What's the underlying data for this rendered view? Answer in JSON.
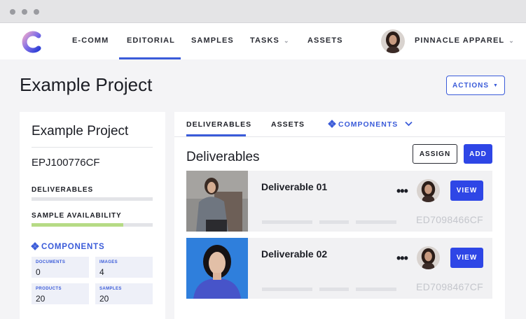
{
  "nav": {
    "items": [
      {
        "label": "E-COMM"
      },
      {
        "label": "EDITORIAL"
      },
      {
        "label": "SAMPLES"
      },
      {
        "label": "TASKS"
      },
      {
        "label": "ASSETS"
      }
    ],
    "org_name": "PINNACLE APPAREL"
  },
  "page": {
    "title": "Example Project",
    "actions_label": "ACTIONS"
  },
  "project": {
    "name": "Example Project",
    "code": "EPJ100776CF",
    "deliverables_label": "DELIVERABLES",
    "deliverables_progress": 0,
    "sample_label": "SAMPLE AVAILABILITY",
    "sample_progress": 0.76,
    "components_label": "COMPONENTS",
    "stats": [
      {
        "label": "DOCUMENTS",
        "value": "0"
      },
      {
        "label": "IMAGES",
        "value": "4"
      },
      {
        "label": "PRODUCTS",
        "value": "20"
      },
      {
        "label": "SAMPLES",
        "value": "20"
      }
    ]
  },
  "tabs": [
    {
      "label": "DELIVERABLES"
    },
    {
      "label": "ASSETS"
    },
    {
      "label": "COMPONENTS"
    }
  ],
  "deliverables": {
    "title": "Deliverables",
    "assign_label": "ASSIGN",
    "add_label": "ADD",
    "rows": [
      {
        "name": "Deliverable 01",
        "code": "ED7098466CF",
        "view_label": "VIEW",
        "more": "•••"
      },
      {
        "name": "Deliverable 02",
        "code": "ED7098467CF",
        "view_label": "VIEW",
        "more": "•••"
      }
    ]
  },
  "icons": {
    "logo": "brand-c-logo",
    "components": "diamond-cluster-icon",
    "dropdown": "chevron-down-icon"
  },
  "colors": {
    "accent": "#3a5bd9",
    "primary_button": "#2e46e6",
    "progress_fill": "#b6db85"
  }
}
